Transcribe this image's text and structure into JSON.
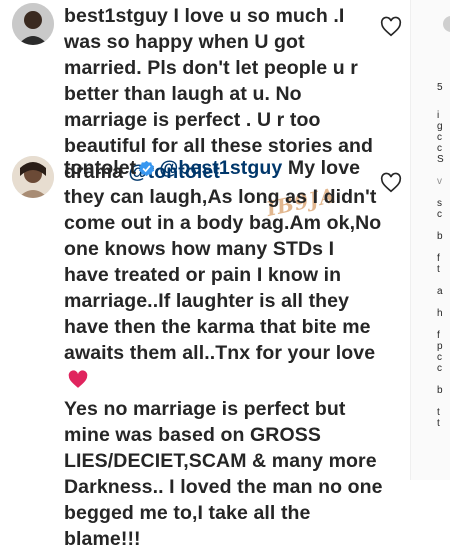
{
  "comments": [
    {
      "username": "best1stguy",
      "body": " I love u so much .I was so happy when U got married. Pls don't let people u r better than laugh at u. No marriage is perfect . U r too beautiful for all these stories and drama ",
      "mention": "@tontolet",
      "like_icon": "heart-outline-icon"
    },
    {
      "username": "tontolet",
      "mention": "@best1stguy",
      "body": " My love they can laugh,As long as I didn't come out in a body bag.Am ok,No one knows how many STDs I have treated or pain I know in marriage..If laughter is all they have then the karma that bite me awaits them all..Tnx for your love",
      "emoji": "red-heart-emoji",
      "body2": "Yes no marriage is perfect but mine was based on GROSS LIES/DECIET,SCAM & many more Darkness.. I loved the man no one begged me to,I take all the blame!!!",
      "like_icon": "heart-outline-icon"
    }
  ],
  "watermark": "IB9JA",
  "sidebar_fragments": [
    "5",
    "i",
    "g",
    "c",
    "c",
    "S",
    "v",
    "s",
    "c",
    "b",
    "f",
    "t",
    "a",
    "h",
    "f",
    "p",
    "c",
    "c",
    "b",
    "t",
    "t"
  ],
  "colors": {
    "text": "#262626",
    "mention": "#00376b",
    "heart": "#ed4956",
    "verified": "#3897f0"
  }
}
